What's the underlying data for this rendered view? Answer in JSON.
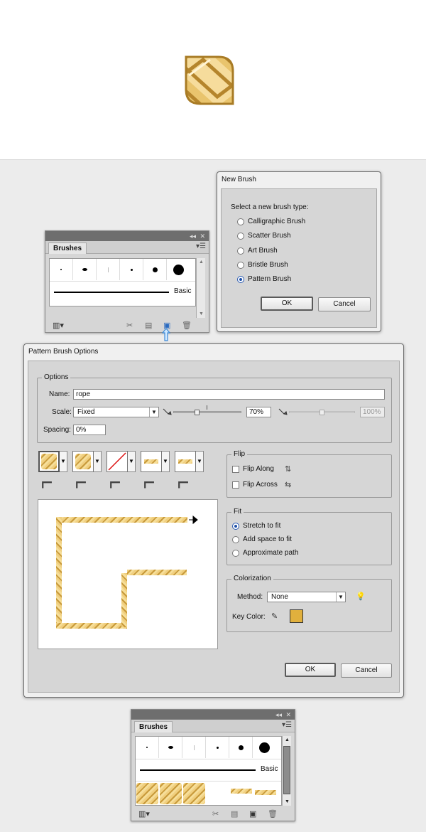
{
  "new_brush": {
    "title": "New Brush",
    "prompt": "Select a new brush type:",
    "options": [
      "Calligraphic Brush",
      "Scatter Brush",
      "Art Brush",
      "Bristle Brush",
      "Pattern Brush"
    ],
    "selected": "Pattern Brush",
    "ok_label": "OK",
    "cancel_label": "Cancel"
  },
  "brushes_panel_1": {
    "tab_label": "Brushes",
    "stroke_label": "Basic"
  },
  "pattern_options": {
    "title": "Pattern Brush Options",
    "options_group": "Options",
    "name_label": "Name:",
    "name_value": "rope",
    "scale_label": "Scale:",
    "scale_value": "Fixed",
    "scale_percent": "70%",
    "scale_percent_max": "100%",
    "spacing_label": "Spacing:",
    "spacing_value": "0%",
    "flip_group": "Flip",
    "flip_along": "Flip Along",
    "flip_across": "Flip Across",
    "fit_group": "Fit",
    "fit_options": [
      "Stretch to fit",
      "Add space to fit",
      "Approximate path"
    ],
    "fit_selected": "Stretch to fit",
    "colorization_group": "Colorization",
    "method_label": "Method:",
    "method_value": "None",
    "key_color_label": "Key Color:",
    "key_color": "#e1b03d",
    "ok_label": "OK",
    "cancel_label": "Cancel"
  },
  "brushes_panel_2": {
    "tab_label": "Brushes",
    "stroke_label": "Basic"
  }
}
